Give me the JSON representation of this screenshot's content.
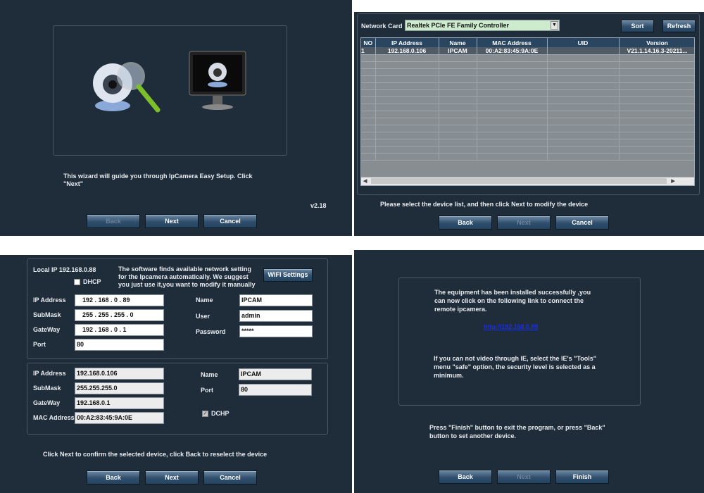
{
  "welcome": {
    "text": "This wizard will guide you through IpCamera Easy Setup. Click \"Next\"",
    "version": "v2.18",
    "buttons": {
      "back": "Back",
      "next": "Next",
      "cancel": "Cancel"
    }
  },
  "search": {
    "network_card_label": "Network Card",
    "network_card_value": "Realtek PCIe FE Family Controller",
    "sort": "Sort",
    "refresh": "Refresh",
    "columns": [
      "NO",
      "IP Address",
      "Name",
      "MAC Address",
      "UID",
      "Version"
    ],
    "rows": [
      [
        "1",
        "192.168.0.106",
        "IPCAM",
        "00:A2:83:45:9A:0E",
        "",
        "V21.1.14.16.3-20211..."
      ]
    ],
    "hint": "Please select the device list, and then click Next to modify the device",
    "buttons": {
      "back": "Back",
      "next": "Next",
      "cancel": "Cancel"
    }
  },
  "config": {
    "local_ip": "Local IP 192.168.0.88",
    "info": "The software finds available network setting for the Ipcamera automatically. We suggest you just use it,you want to modify it manually",
    "wifi": "WIFI Settings",
    "dhcp": "DHCP",
    "labels": {
      "ip": "IP Address",
      "mask": "SubMask",
      "gateway": "GateWay",
      "port": "Port",
      "name": "Name",
      "user": "User",
      "password": "Password",
      "mac": "MAC Address"
    },
    "new": {
      "ip": "192  .  168  .   0   .   89",
      "mask": "255  .  255  .  255  .   0",
      "gateway": "192  .  168  .   0   .   1",
      "port": "80",
      "name": "IPCAM",
      "user": "admin",
      "password": "*****"
    },
    "current": {
      "ip": "192.168.0.106",
      "mask": "255.255.255.0",
      "gateway": "192.168.0.1",
      "mac": "00:A2:83:45:9A:0E",
      "name": "IPCAM",
      "port": "80",
      "dchp": "DCHP"
    },
    "hint": "Click Next to confirm the selected device, click Back to reselect the device",
    "buttons": {
      "back": "Back",
      "next": "Next",
      "cancel": "Cancel"
    }
  },
  "finish": {
    "msg1": "The equipment has been installed successfully ,you can now click on the following link to connect the remote ipcamera.",
    "link": "http://192.168.0.89",
    "msg2": "If you can not video through IE, select the IE's \"Tools\" menu  \"safe\" option, the security level is selected as a minimum.",
    "hint": "Press \"Finish\" button to exit the program, or press \"Back\" button to set another device.",
    "buttons": {
      "back": "Back",
      "next": "Next",
      "finish": "Finish"
    }
  }
}
